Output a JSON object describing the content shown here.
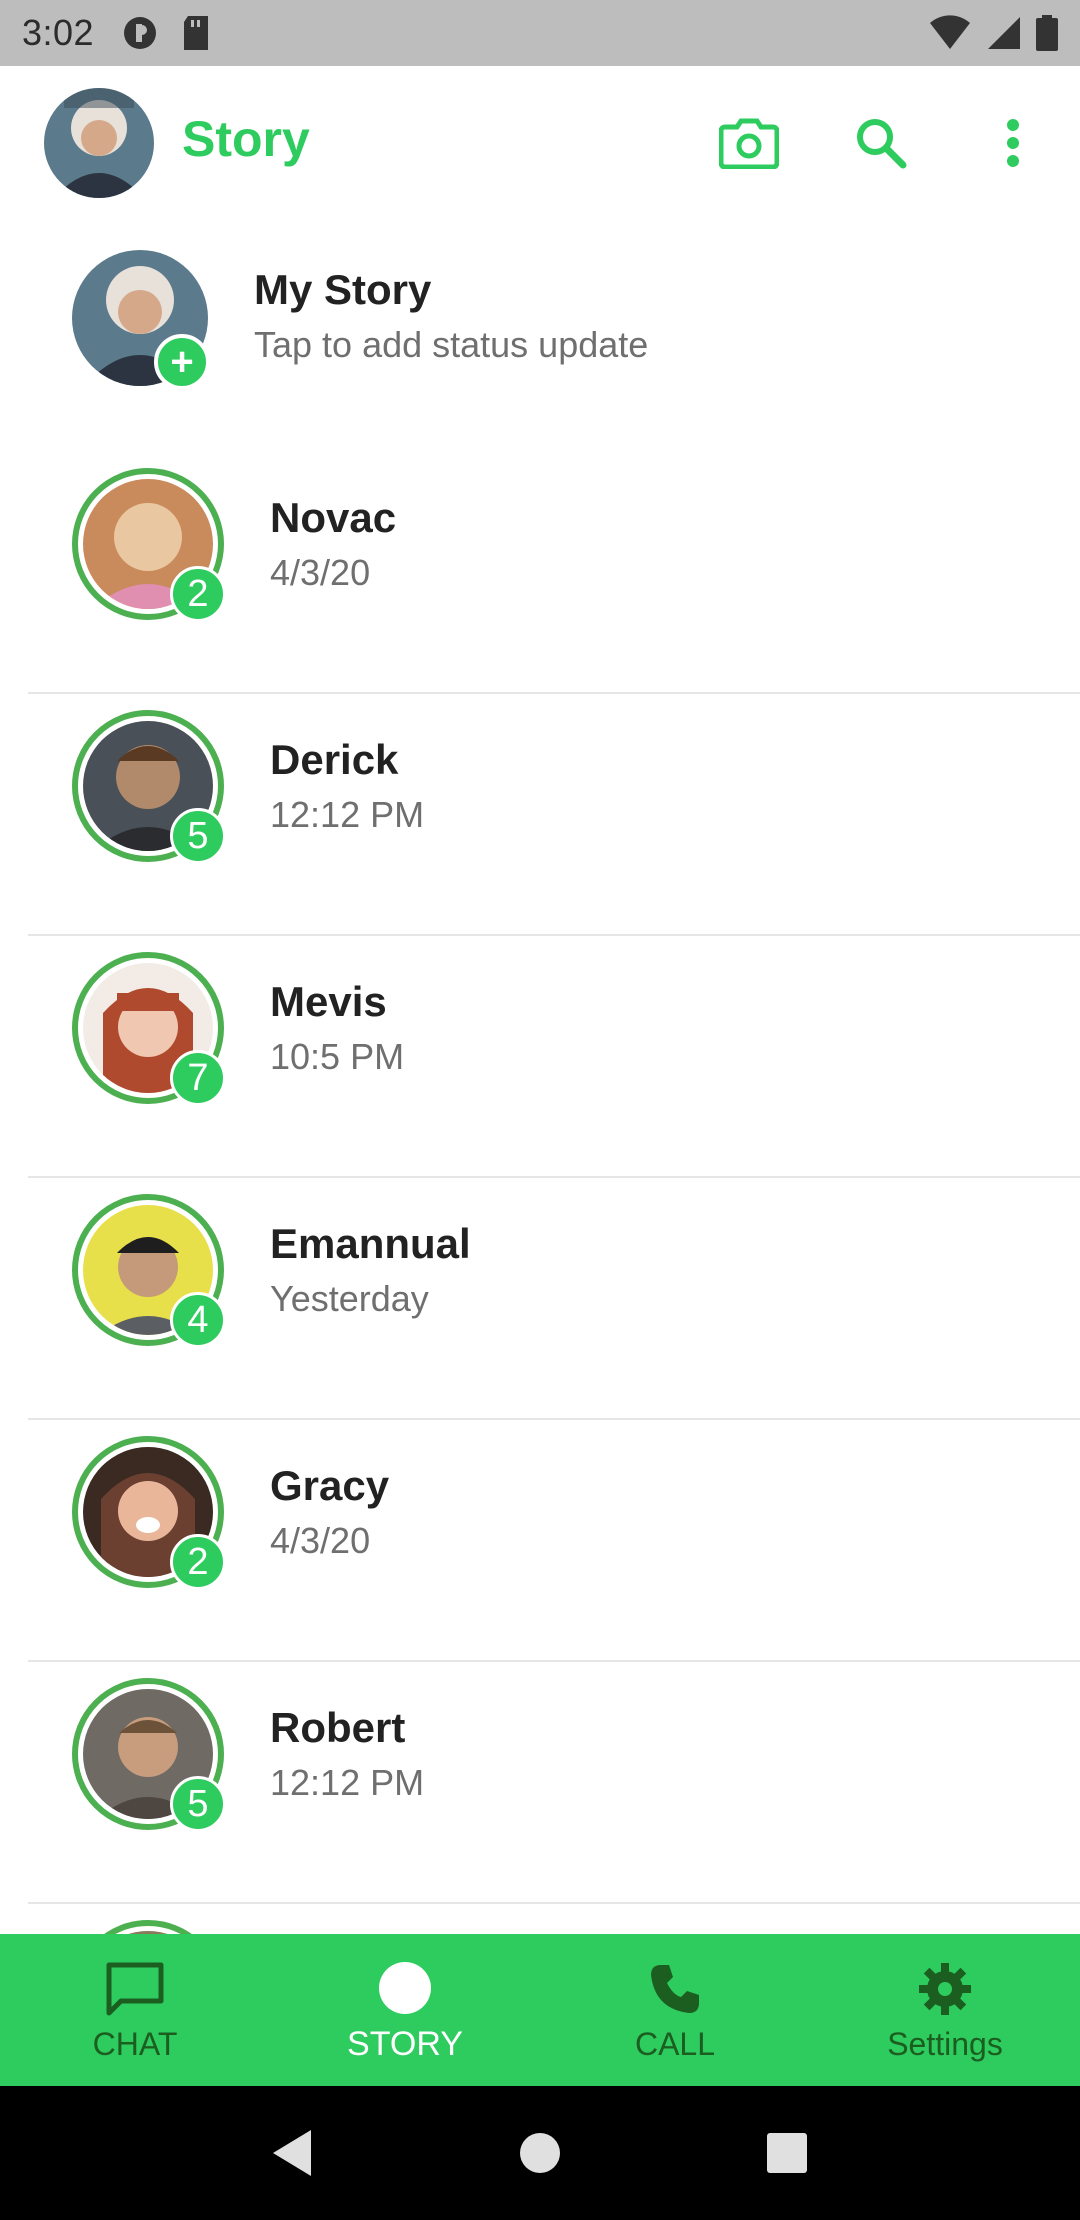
{
  "status_bar": {
    "time": "3:02"
  },
  "app_bar": {
    "title": "Story"
  },
  "my_story": {
    "title": "My Story",
    "subtitle": "Tap to add status update",
    "plus": "+"
  },
  "stories": [
    {
      "name": "Novac",
      "time": "4/3/20",
      "count": "2",
      "colors": [
        "#c98b5b",
        "#e9c7a0"
      ]
    },
    {
      "name": "Derick",
      "time": "12:12 PM",
      "count": "5",
      "colors": [
        "#4a5058",
        "#b08a6a"
      ]
    },
    {
      "name": "Mevis",
      "time": "10:5 PM",
      "count": "7",
      "colors": [
        "#b04a2e",
        "#f0c7b0"
      ]
    },
    {
      "name": "Emannual",
      "time": "Yesterday",
      "count": "4",
      "colors": [
        "#e8e04a",
        "#7a5a40"
      ]
    },
    {
      "name": "Gracy",
      "time": "4/3/20",
      "count": "2",
      "colors": [
        "#6b4030",
        "#e9b69a"
      ]
    },
    {
      "name": "Robert",
      "time": "12:12 PM",
      "count": "5",
      "colors": [
        "#6f6a63",
        "#c79d7d"
      ]
    }
  ],
  "bottom_nav": [
    {
      "label": "CHAT",
      "icon": "chat-icon"
    },
    {
      "label": "STORY",
      "icon": "story-circle-icon"
    },
    {
      "label": "CALL",
      "icon": "phone-icon"
    },
    {
      "label": "Settings",
      "icon": "gear-icon"
    }
  ],
  "colors": {
    "accent": "#2ecc5f",
    "ring": "#4caf50",
    "nav_inactive": "#1b5e20"
  }
}
